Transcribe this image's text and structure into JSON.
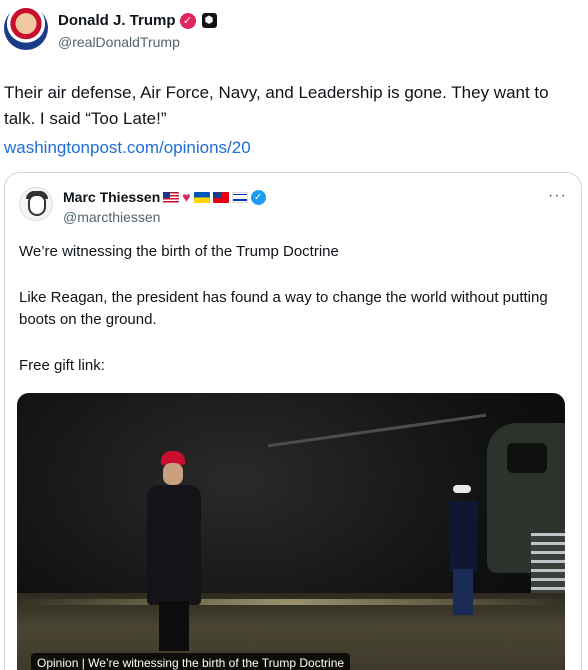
{
  "post": {
    "author_name": "Donald J. Trump",
    "author_handle": "@realDonaldTrump",
    "text": "Their air defense, Air Force, Navy, and Leadership is gone. They want to talk. I said “Too Late!”",
    "link_text": "washingtonpost.com/opinions/20"
  },
  "quote": {
    "author_name": "Marc Thiessen",
    "author_handle": "@marcthiessen",
    "more_label": "···",
    "line1": "We’re witnessing the birth of the Trump Doctrine",
    "line2": "Like Reagan, the president has found a way to change the world without putting boots on the ground.",
    "line3": "Free gift link:",
    "media_caption": "Opinion | We’re witnessing the birth of the Trump Doctrine"
  },
  "colors": {
    "link": "#1d6ddb",
    "verified_blue": "#1d9bf0",
    "verified_pink": "#e0245e",
    "secondary_text": "#536471"
  }
}
